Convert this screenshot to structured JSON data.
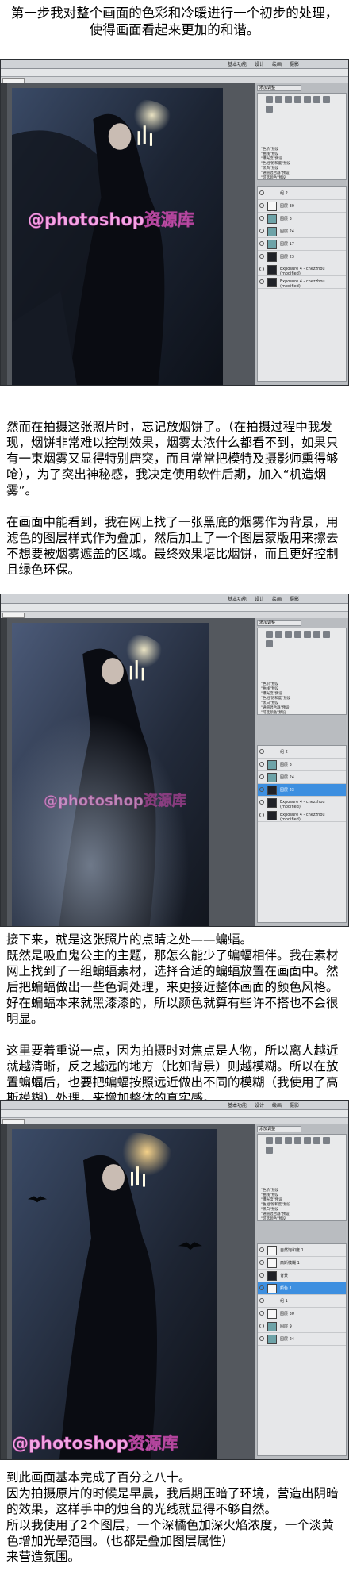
{
  "intro": {
    "lines": [
      "第一步我对整个画面的色彩和冷暖进行一个初步的处理，",
      "使得画面看起来更加的和谐。"
    ]
  },
  "text2": {
    "p1": "然而在拍摄这张照片时，忘记放烟饼了。（在拍摄过程中我发现，烟饼非常难以控制效果，烟雾太浓什么都看不到，如果只有一束烟雾又显得特别唐突，而且常常把模特及摄影师熏得够呛），为了突出神秘感，我决定使用软件后期，加入“机造烟雾”。",
    "p2": "在画面中能看到，我在网上找了一张黑底的烟雾作为背景，用滤色的图层样式作为叠加，然后加上了一个图层蒙版用来擦去不想要被烟雾遮盖的区域。最终效果堪比烟饼，而且更好控制且绿色环保。"
  },
  "text3": {
    "p1": "接下来，就是这张照片的点睛之处——蝙蝠。\n既然是吸血鬼公主的主题，那怎么能少了蝙蝠相伴。我在素材网上找到了一组蝙蝠素材，选择合适的蝙蝠放置在画面中。然后把蝙蝠做出一些色调处理，来更接近整体画面的颜色风格。好在蝙蝠本来就黑漆漆的，所以颜色就算有些许不搭也不会很明显。",
    "p2": "这里要着重说一点，因为拍摄时对焦点是人物，所以离人越近就越清晰，反之越远的地方（比如背景）则越模糊。所以在放置蝙蝠后，也要把蝙蝠按照远近做出不同的模糊（我使用了高斯模糊）处理，来增加整体的真实感。"
  },
  "text4": {
    "p1": "到此画面基本完成了百分之八十。\n因为拍摄原片的时候是早晨，我后期压暗了环境，营造出阴暗的效果，这样手中的烛台的光线就显得不够自然。\n所以我使用了2个图层，一个深橘色加深火焰浓度，一个淡黄色增加光晕范围。（也都是叠加图层属性）\n来营造氛围。"
  },
  "watermark": "@photoshop资源库",
  "ps": {
    "workspace": [
      "基本功能",
      "设计",
      "绘画",
      "摄影"
    ],
    "adjust_tab": "添加调整",
    "presets": [
      "\"色阶\"预设",
      "\"曲线\"预设",
      "\"曝光度\"预设",
      "\"色相/饱和度\"预设",
      "\"黑白\"预设",
      "\"通道混合器\"预设",
      "\"可选颜色\"预设"
    ],
    "layers1": [
      "组 2",
      "图层 30",
      "图层 3",
      "图层 24",
      "图层 17",
      "图层 23",
      "Exposure 4 - chezzhou (modified)",
      "Exposure 4 - chezzhou (modified)"
    ],
    "layers2": [
      "组 2",
      "图层 3",
      "图层 24",
      "图层 23",
      "Exposure 4 - chezzhou (modified)",
      "Exposure 4 - chezzhou (modified)"
    ],
    "layers3": [
      "自然饱和度 1",
      "高斯模糊 1",
      "背景",
      "颜色 1",
      "组 1",
      "图层 30",
      "图层 9",
      "图层 24"
    ],
    "colors": {
      "panel": "#b9bcc0",
      "selected": "#3d8fe0",
      "watermark": "#f2a6e4"
    }
  }
}
